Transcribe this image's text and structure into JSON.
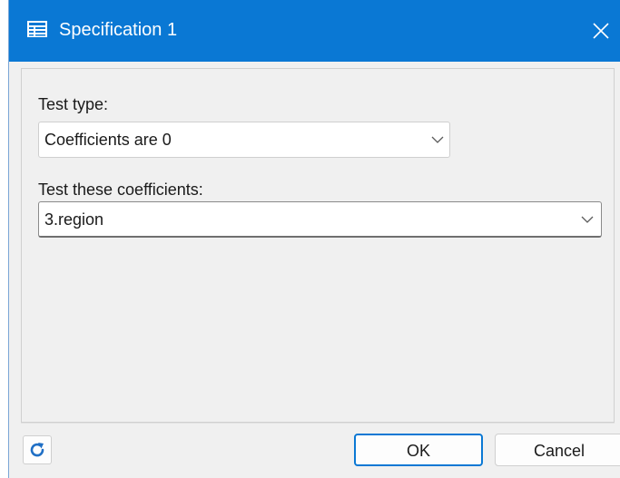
{
  "window": {
    "title": "Specification 1",
    "title_icon": "table-icon",
    "close_icon": "close-icon"
  },
  "form": {
    "test_type": {
      "label": "Test type:",
      "selected": "Coefficients are 0"
    },
    "coefficients": {
      "label": "Test these coefficients:",
      "selected": "3.region"
    }
  },
  "footer": {
    "refresh_icon": "refresh-icon",
    "ok_label": "OK",
    "cancel_label": "Cancel"
  },
  "colors": {
    "titlebar": "#0a78d4",
    "accent": "#0a78d4"
  }
}
